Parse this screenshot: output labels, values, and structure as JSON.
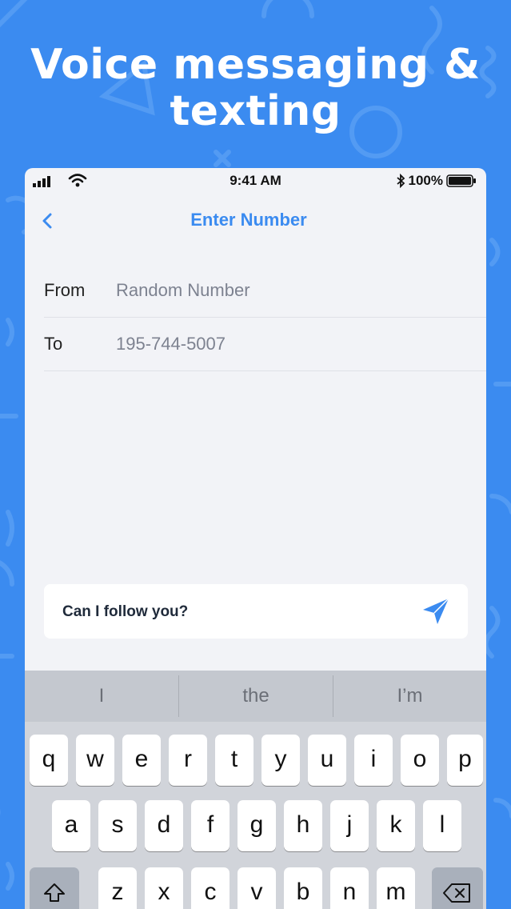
{
  "headline": {
    "line1": "Voice messaging &",
    "line2": "texting"
  },
  "status_bar": {
    "time": "9:41 AM",
    "battery": "100%"
  },
  "nav": {
    "title": "Enter Number"
  },
  "fields": [
    {
      "label": "From",
      "value": "Random Number"
    },
    {
      "label": "To",
      "value": "195-744-5007"
    }
  ],
  "composer": {
    "text": "Can I follow you?"
  },
  "keyboard": {
    "suggestions": [
      "I",
      "the",
      "I’m"
    ],
    "row1": [
      "q",
      "w",
      "e",
      "r",
      "t",
      "y",
      "u",
      "i",
      "o",
      "p"
    ],
    "row2": [
      "a",
      "s",
      "d",
      "f",
      "g",
      "h",
      "j",
      "k",
      "l"
    ],
    "row3": [
      "z",
      "x",
      "c",
      "v",
      "b",
      "n",
      "m"
    ]
  },
  "colors": {
    "brand_blue": "#3b8bf0",
    "keyboard_bg": "#d1d4da"
  }
}
